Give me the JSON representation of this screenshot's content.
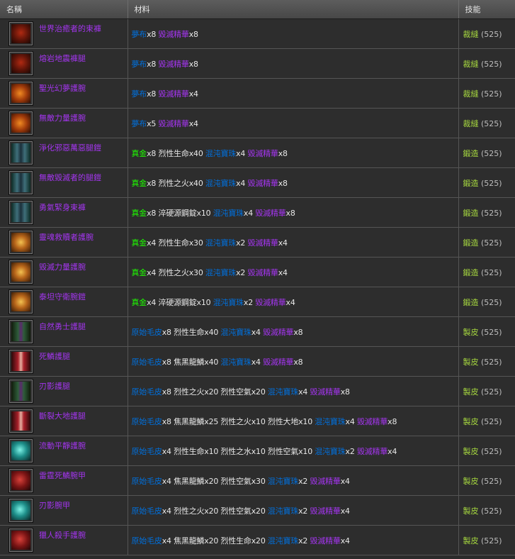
{
  "header": {
    "name": "名稱",
    "materials": "材料",
    "skill": "技能"
  },
  "rows": [
    {
      "icon": "pants-red-icon",
      "name": "世界治癒者的束褲",
      "materials": [
        {
          "text": "夢布",
          "color": "#0070dd"
        },
        {
          "text": "x8 ",
          "color": "#e8e8e8"
        },
        {
          "text": "毀滅精華",
          "color": "#a335ee"
        },
        {
          "text": "x8",
          "color": "#e8e8e8"
        }
      ],
      "skill": "裁縫",
      "level": "(525)"
    },
    {
      "icon": "pants-red-icon",
      "name": "熔岩地震褲腿",
      "materials": [
        {
          "text": "夢布",
          "color": "#0070dd"
        },
        {
          "text": "x8 ",
          "color": "#e8e8e8"
        },
        {
          "text": "毀滅精華",
          "color": "#a335ee"
        },
        {
          "text": "x8",
          "color": "#e8e8e8"
        }
      ],
      "skill": "裁縫",
      "level": "(525)"
    },
    {
      "icon": "bracer-orange-icon",
      "name": "聖光幻夢護腕",
      "materials": [
        {
          "text": "夢布",
          "color": "#0070dd"
        },
        {
          "text": "x8 ",
          "color": "#e8e8e8"
        },
        {
          "text": "毀滅精華",
          "color": "#a335ee"
        },
        {
          "text": "x4",
          "color": "#e8e8e8"
        }
      ],
      "skill": "裁縫",
      "level": "(525)"
    },
    {
      "icon": "bracer-orange-icon",
      "name": "無敵力量護腕",
      "materials": [
        {
          "text": "夢布",
          "color": "#0070dd"
        },
        {
          "text": "x5 ",
          "color": "#e8e8e8"
        },
        {
          "text": "毀滅精華",
          "color": "#a335ee"
        },
        {
          "text": "x4",
          "color": "#e8e8e8"
        }
      ],
      "skill": "裁縫",
      "level": "(525)"
    },
    {
      "icon": "leggings-plate-icon",
      "name": "淨化邪惡萬惡腿鎧",
      "materials": [
        {
          "text": "真金",
          "color": "#1eff00"
        },
        {
          "text": "x8 烈性生命x40 ",
          "color": "#e8e8e8"
        },
        {
          "text": "混沌寶珠",
          "color": "#0070dd"
        },
        {
          "text": "x4 ",
          "color": "#e8e8e8"
        },
        {
          "text": "毀滅精華",
          "color": "#a335ee"
        },
        {
          "text": "x8",
          "color": "#e8e8e8"
        }
      ],
      "skill": "鍛造",
      "level": "(525)"
    },
    {
      "icon": "leggings-plate-icon",
      "name": "無敵毀滅者的腿鎧",
      "materials": [
        {
          "text": "真金",
          "color": "#1eff00"
        },
        {
          "text": "x8 烈性之火x40 ",
          "color": "#e8e8e8"
        },
        {
          "text": "混沌寶珠",
          "color": "#0070dd"
        },
        {
          "text": "x4 ",
          "color": "#e8e8e8"
        },
        {
          "text": "毀滅精華",
          "color": "#a335ee"
        },
        {
          "text": "x8",
          "color": "#e8e8e8"
        }
      ],
      "skill": "鍛造",
      "level": "(525)"
    },
    {
      "icon": "leggings-plate-icon",
      "name": "勇氣緊身束褲",
      "materials": [
        {
          "text": "真金",
          "color": "#1eff00"
        },
        {
          "text": "x8 淬硬源鋼錠x10 ",
          "color": "#e8e8e8"
        },
        {
          "text": "混沌寶珠",
          "color": "#0070dd"
        },
        {
          "text": "x4 ",
          "color": "#e8e8e8"
        },
        {
          "text": "毀滅精華",
          "color": "#a335ee"
        },
        {
          "text": "x8",
          "color": "#e8e8e8"
        }
      ],
      "skill": "鍛造",
      "level": "(525)"
    },
    {
      "icon": "bracer-gold-icon",
      "name": "靈魂救贖者護腕",
      "materials": [
        {
          "text": "真金",
          "color": "#1eff00"
        },
        {
          "text": "x4 烈性生命x30 ",
          "color": "#e8e8e8"
        },
        {
          "text": "混沌寶珠",
          "color": "#0070dd"
        },
        {
          "text": "x2 ",
          "color": "#e8e8e8"
        },
        {
          "text": "毀滅精華",
          "color": "#a335ee"
        },
        {
          "text": "x4",
          "color": "#e8e8e8"
        }
      ],
      "skill": "鍛造",
      "level": "(525)"
    },
    {
      "icon": "bracer-gold-icon",
      "name": "毀滅力量護腕",
      "materials": [
        {
          "text": "真金",
          "color": "#1eff00"
        },
        {
          "text": "x4 烈性之火x30 ",
          "color": "#e8e8e8"
        },
        {
          "text": "混沌寶珠",
          "color": "#0070dd"
        },
        {
          "text": "x2 ",
          "color": "#e8e8e8"
        },
        {
          "text": "毀滅精華",
          "color": "#a335ee"
        },
        {
          "text": "x4",
          "color": "#e8e8e8"
        }
      ],
      "skill": "鍛造",
      "level": "(525)"
    },
    {
      "icon": "bracer-gold-icon",
      "name": "泰坦守衛腕鎧",
      "materials": [
        {
          "text": "真金",
          "color": "#1eff00"
        },
        {
          "text": "x4 淬硬源鋼錠x10 ",
          "color": "#e8e8e8"
        },
        {
          "text": "混沌寶珠",
          "color": "#0070dd"
        },
        {
          "text": "x2 ",
          "color": "#e8e8e8"
        },
        {
          "text": "毀滅精華",
          "color": "#a335ee"
        },
        {
          "text": "x4",
          "color": "#e8e8e8"
        }
      ],
      "skill": "鍛造",
      "level": "(525)"
    },
    {
      "icon": "leggings-leather-green-icon",
      "name": "自然勇士護腿",
      "materials": [
        {
          "text": "原始毛皮",
          "color": "#0070dd"
        },
        {
          "text": "x8 烈性生命x40 ",
          "color": "#e8e8e8"
        },
        {
          "text": "混沌寶珠",
          "color": "#0070dd"
        },
        {
          "text": "x4 ",
          "color": "#e8e8e8"
        },
        {
          "text": "毀滅精華",
          "color": "#a335ee"
        },
        {
          "text": "x8",
          "color": "#e8e8e8"
        }
      ],
      "skill": "製皮",
      "level": "(525)"
    },
    {
      "icon": "leggings-leather-red-icon",
      "name": "死鱗護腿",
      "materials": [
        {
          "text": "原始毛皮",
          "color": "#0070dd"
        },
        {
          "text": "x8 焦黑龍鱗x40 ",
          "color": "#e8e8e8"
        },
        {
          "text": "混沌寶珠",
          "color": "#0070dd"
        },
        {
          "text": "x4 ",
          "color": "#e8e8e8"
        },
        {
          "text": "毀滅精華",
          "color": "#a335ee"
        },
        {
          "text": "x8",
          "color": "#e8e8e8"
        }
      ],
      "skill": "製皮",
      "level": "(525)"
    },
    {
      "icon": "leggings-leather-green-icon",
      "name": "刃影護腿",
      "materials": [
        {
          "text": "原始毛皮",
          "color": "#0070dd"
        },
        {
          "text": "x8 烈性之火x20 烈性空氣x20 ",
          "color": "#e8e8e8"
        },
        {
          "text": "混沌寶珠",
          "color": "#0070dd"
        },
        {
          "text": "x4 ",
          "color": "#e8e8e8"
        },
        {
          "text": "毀滅精華",
          "color": "#a335ee"
        },
        {
          "text": "x8",
          "color": "#e8e8e8"
        }
      ],
      "skill": "製皮",
      "level": "(525)"
    },
    {
      "icon": "leggings-leather-red-icon",
      "name": "斷裂大地護腿",
      "materials": [
        {
          "text": "原始毛皮",
          "color": "#0070dd"
        },
        {
          "text": "x8 焦黑龍鱗x25 烈性之火x10 烈性大地x10 ",
          "color": "#e8e8e8"
        },
        {
          "text": "混沌寶珠",
          "color": "#0070dd"
        },
        {
          "text": "x4 ",
          "color": "#e8e8e8"
        },
        {
          "text": "毀滅精華",
          "color": "#a335ee"
        },
        {
          "text": "x8",
          "color": "#e8e8e8"
        }
      ],
      "skill": "製皮",
      "level": "(525)"
    },
    {
      "icon": "bracer-teal-icon",
      "name": "流動平靜護腕",
      "materials": [
        {
          "text": "原始毛皮",
          "color": "#0070dd"
        },
        {
          "text": "x4 烈性生命x10 烈性之水x10 烈性空氣x10 ",
          "color": "#e8e8e8"
        },
        {
          "text": "混沌寶珠",
          "color": "#0070dd"
        },
        {
          "text": "x2 ",
          "color": "#e8e8e8"
        },
        {
          "text": "毀滅精華",
          "color": "#a335ee"
        },
        {
          "text": "x4",
          "color": "#e8e8e8"
        }
      ],
      "skill": "製皮",
      "level": "(525)"
    },
    {
      "icon": "bracer-red-icon",
      "name": "雷霆死鱗腕甲",
      "materials": [
        {
          "text": "原始毛皮",
          "color": "#0070dd"
        },
        {
          "text": "x4 焦黑龍鱗x20 烈性空氣x30 ",
          "color": "#e8e8e8"
        },
        {
          "text": "混沌寶珠",
          "color": "#0070dd"
        },
        {
          "text": "x2 ",
          "color": "#e8e8e8"
        },
        {
          "text": "毀滅精華",
          "color": "#a335ee"
        },
        {
          "text": "x4",
          "color": "#e8e8e8"
        }
      ],
      "skill": "製皮",
      "level": "(525)"
    },
    {
      "icon": "bracer-teal-icon",
      "name": "刃影腕甲",
      "materials": [
        {
          "text": "原始毛皮",
          "color": "#0070dd"
        },
        {
          "text": "x4 烈性之火x20 烈性空氣x20 ",
          "color": "#e8e8e8"
        },
        {
          "text": "混沌寶珠",
          "color": "#0070dd"
        },
        {
          "text": "x2 ",
          "color": "#e8e8e8"
        },
        {
          "text": "毀滅精華",
          "color": "#a335ee"
        },
        {
          "text": "x4",
          "color": "#e8e8e8"
        }
      ],
      "skill": "製皮",
      "level": "(525)"
    },
    {
      "icon": "bracer-red-icon",
      "name": "獵人殺手護腕",
      "materials": [
        {
          "text": "原始毛皮",
          "color": "#0070dd"
        },
        {
          "text": "x4 焦黑龍鱗x20 烈性生命x20 ",
          "color": "#e8e8e8"
        },
        {
          "text": "混沌寶珠",
          "color": "#0070dd"
        },
        {
          "text": "x2 ",
          "color": "#e8e8e8"
        },
        {
          "text": "毀滅精華",
          "color": "#a335ee"
        },
        {
          "text": "x4",
          "color": "#e8e8e8"
        }
      ],
      "skill": "製皮",
      "level": "(525)"
    }
  ]
}
